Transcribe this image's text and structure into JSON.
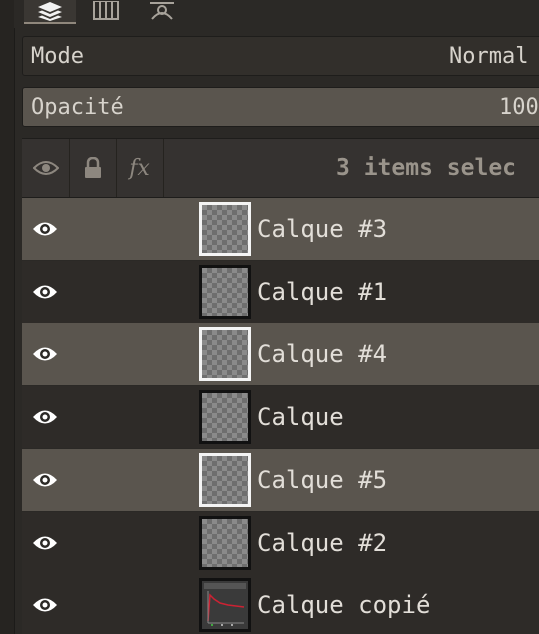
{
  "tabs": [
    {
      "icon": "layers-icon",
      "active": true
    },
    {
      "icon": "channels-icon",
      "active": false
    },
    {
      "icon": "paths-icon",
      "active": false
    }
  ],
  "mode": {
    "label": "Mode",
    "value": "Normal"
  },
  "opacity": {
    "label": "Opacité",
    "value": "100"
  },
  "header": {
    "visibility_icon": "eye-icon",
    "lock_icon": "lock-icon",
    "fx_label": "fx",
    "selection_text": "3 items selec"
  },
  "layers": [
    {
      "name": "Calque #3",
      "selected": true,
      "visible": true
    },
    {
      "name": "Calque #1",
      "selected": false,
      "visible": true
    },
    {
      "name": "Calque #4",
      "selected": true,
      "visible": true
    },
    {
      "name": "Calque",
      "selected": false,
      "visible": true
    },
    {
      "name": "Calque #5",
      "selected": true,
      "visible": true
    },
    {
      "name": "Calque #2",
      "selected": false,
      "visible": true
    },
    {
      "name": "Calque copié",
      "selected": false,
      "visible": true
    }
  ],
  "colors": {
    "background": "#2b2926",
    "selected_row": "#5a554e",
    "plain_row": "#2e2b28",
    "text": "#e2ded8"
  }
}
